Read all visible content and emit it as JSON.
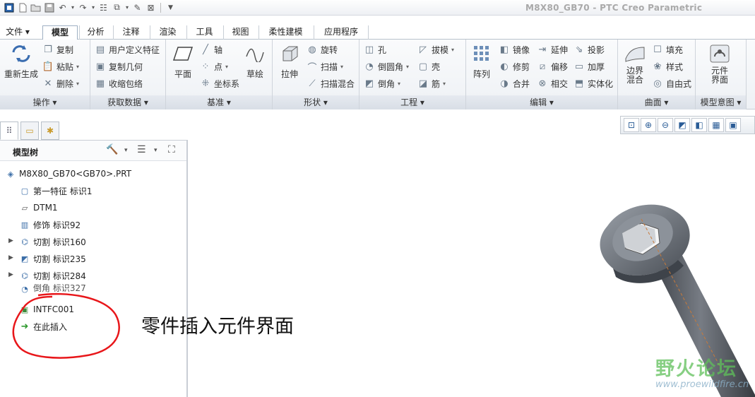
{
  "window": {
    "title": "M8X80_GB70 - PTC Creo Parametric"
  },
  "quick_access": {
    "icons": [
      "app-icon",
      "new-icon",
      "open-icon",
      "save-icon",
      "undo-icon",
      "redo-icon",
      "regenerate-icon",
      "windows-icon",
      "close-window-icon",
      "customize-icon"
    ]
  },
  "tabs": [
    {
      "label": "文件 ▾"
    },
    {
      "label": "模型"
    },
    {
      "label": "分析"
    },
    {
      "label": "注释"
    },
    {
      "label": "渲染"
    },
    {
      "label": "工具"
    },
    {
      "label": "视图"
    },
    {
      "label": "柔性建模"
    },
    {
      "label": "应用程序"
    }
  ],
  "ribbon": {
    "operations": {
      "regenerate": "重新生成",
      "copy": "复制",
      "paste": "粘贴",
      "delete": "删除",
      "footer": "操作 ▾"
    },
    "get_data": {
      "udf": "用户定义特征",
      "copy_geom": "复制几何",
      "shrinkwrap": "收缩包络",
      "footer": "获取数据 ▾"
    },
    "datum": {
      "plane": "平面",
      "axis": "轴",
      "point": "点",
      "csys": "坐标系",
      "sketch": "草绘",
      "footer": "基准 ▾"
    },
    "shapes": {
      "extrude": "拉伸",
      "revolve": "旋转",
      "sweep": "扫描",
      "swept_blend": "扫描混合",
      "footer": "形状 ▾"
    },
    "engineering": {
      "hole": "孔",
      "round": "倒圆角",
      "chamfer": "倒角",
      "draft": "拔模",
      "shell": "壳",
      "rib": "筋",
      "footer": "工程 ▾"
    },
    "editing": {
      "pattern": "阵列",
      "mirror": "镜像",
      "trim": "修剪",
      "merge": "合并",
      "extend": "延伸",
      "offset": "偏移",
      "intersect": "相交",
      "project": "投影",
      "thicken": "加厚",
      "solidify": "实体化",
      "footer": "编辑 ▾"
    },
    "surfaces": {
      "boundary_blend": "边界混合",
      "fill": "填充",
      "style": "样式",
      "freestyle": "自由式",
      "footer": "曲面 ▾"
    },
    "model_intent": {
      "component_interface": "元件界面",
      "footer": "模型意图 ▾"
    }
  },
  "model_tree": {
    "title": "模型树",
    "nodes": [
      {
        "label": "M8X80_GB70<GB70>.PRT"
      },
      {
        "label": "第一特征 标识1"
      },
      {
        "label": "DTM1"
      },
      {
        "label": "修饰 标识92"
      },
      {
        "label": "切割 标识160"
      },
      {
        "label": "切割 标识235"
      },
      {
        "label": "切割 标识284"
      },
      {
        "label": "倒角 标识327"
      },
      {
        "label": "INTFC001"
      },
      {
        "label": "在此插入"
      }
    ]
  },
  "annotation": {
    "text": "零件插入元件界面"
  },
  "watermark": {
    "text": "野火论坛",
    "url": "www.proewildfire.cn"
  }
}
